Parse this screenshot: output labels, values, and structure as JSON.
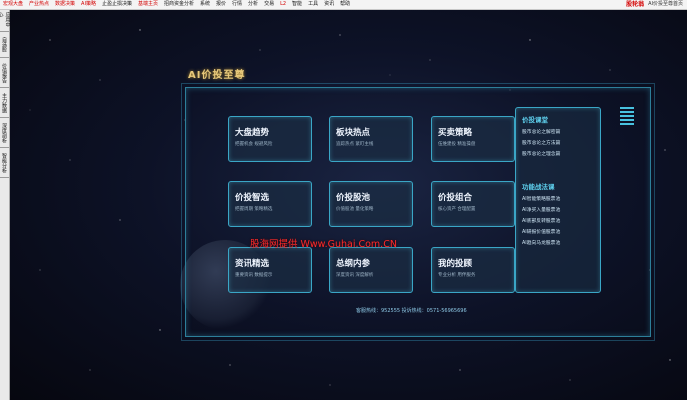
{
  "menubar": {
    "items": [
      {
        "label": "宏观大盘",
        "red": true
      },
      {
        "label": "产业热点",
        "red": true
      },
      {
        "label": "数据决策",
        "red": true
      },
      {
        "label": "AI策略",
        "red": true
      },
      {
        "label": "止盈止损决策",
        "red": false
      },
      {
        "label": "基端主页",
        "red": true
      },
      {
        "label": "招商资金分析",
        "red": false
      },
      {
        "label": "系统",
        "red": false
      },
      {
        "label": "报价",
        "red": false
      },
      {
        "label": "行情",
        "red": false
      },
      {
        "label": "分析",
        "red": false
      },
      {
        "label": "交易",
        "red": false
      },
      {
        "label": "L2",
        "red": true
      },
      {
        "label": "智能",
        "red": false
      },
      {
        "label": "工具",
        "red": false
      },
      {
        "label": "资讯",
        "red": false
      },
      {
        "label": "帮助",
        "red": false
      }
    ],
    "brand_logo": "股轮翁",
    "brand_sub": "AI价投至尊首页"
  },
  "sidebar": {
    "tabs": [
      "应用中心",
      "自选股",
      "价值报告",
      "主力数据",
      "深度剖析",
      "智能分析"
    ]
  },
  "main": {
    "title": "AI价投至尊",
    "tiles": [
      {
        "title": "大盘趋势",
        "sub": "把握机会  规避风险"
      },
      {
        "title": "板块热点",
        "sub": "追踪热点  紧盯主线"
      },
      {
        "title": "买卖策略",
        "sub": "伍维建投  精准操盘"
      },
      {
        "title": "价投智选",
        "sub": "把握周期  策略精选"
      },
      {
        "title": "价投股池",
        "sub": "价值股池  量化策略"
      },
      {
        "title": "价投组合",
        "sub": "核心资产  合理配置"
      },
      {
        "title": "资讯精选",
        "sub": "重要资讯  数据提示"
      },
      {
        "title": "总纲内参",
        "sub": "深度资讯  深度解析"
      },
      {
        "title": "我的投顾",
        "sub": "专业分析  用伴服务"
      }
    ],
    "panel": {
      "heading1": "价投课堂",
      "links1": [
        "股市总论之解密篇",
        "股市总论之方法篇",
        "股市总论之理念篇"
      ],
      "heading2": "功能战法课",
      "links2": [
        "AI智能策略股票池",
        "AI净买入量股票池",
        "AI底部反转股票池",
        "AI研报价值股票池",
        "AI趋向马龙股票池"
      ]
    },
    "watermark": "股海网提供 Www.Guhai.Com.CN",
    "hotline": "客服热线：952555  投诉热线：0571-56965696"
  },
  "colors": {
    "accent": "#3aa6c6",
    "title_gold": "#e7c87a",
    "menu_red": "#d40000",
    "watermark_red": "#ff2a2a"
  }
}
